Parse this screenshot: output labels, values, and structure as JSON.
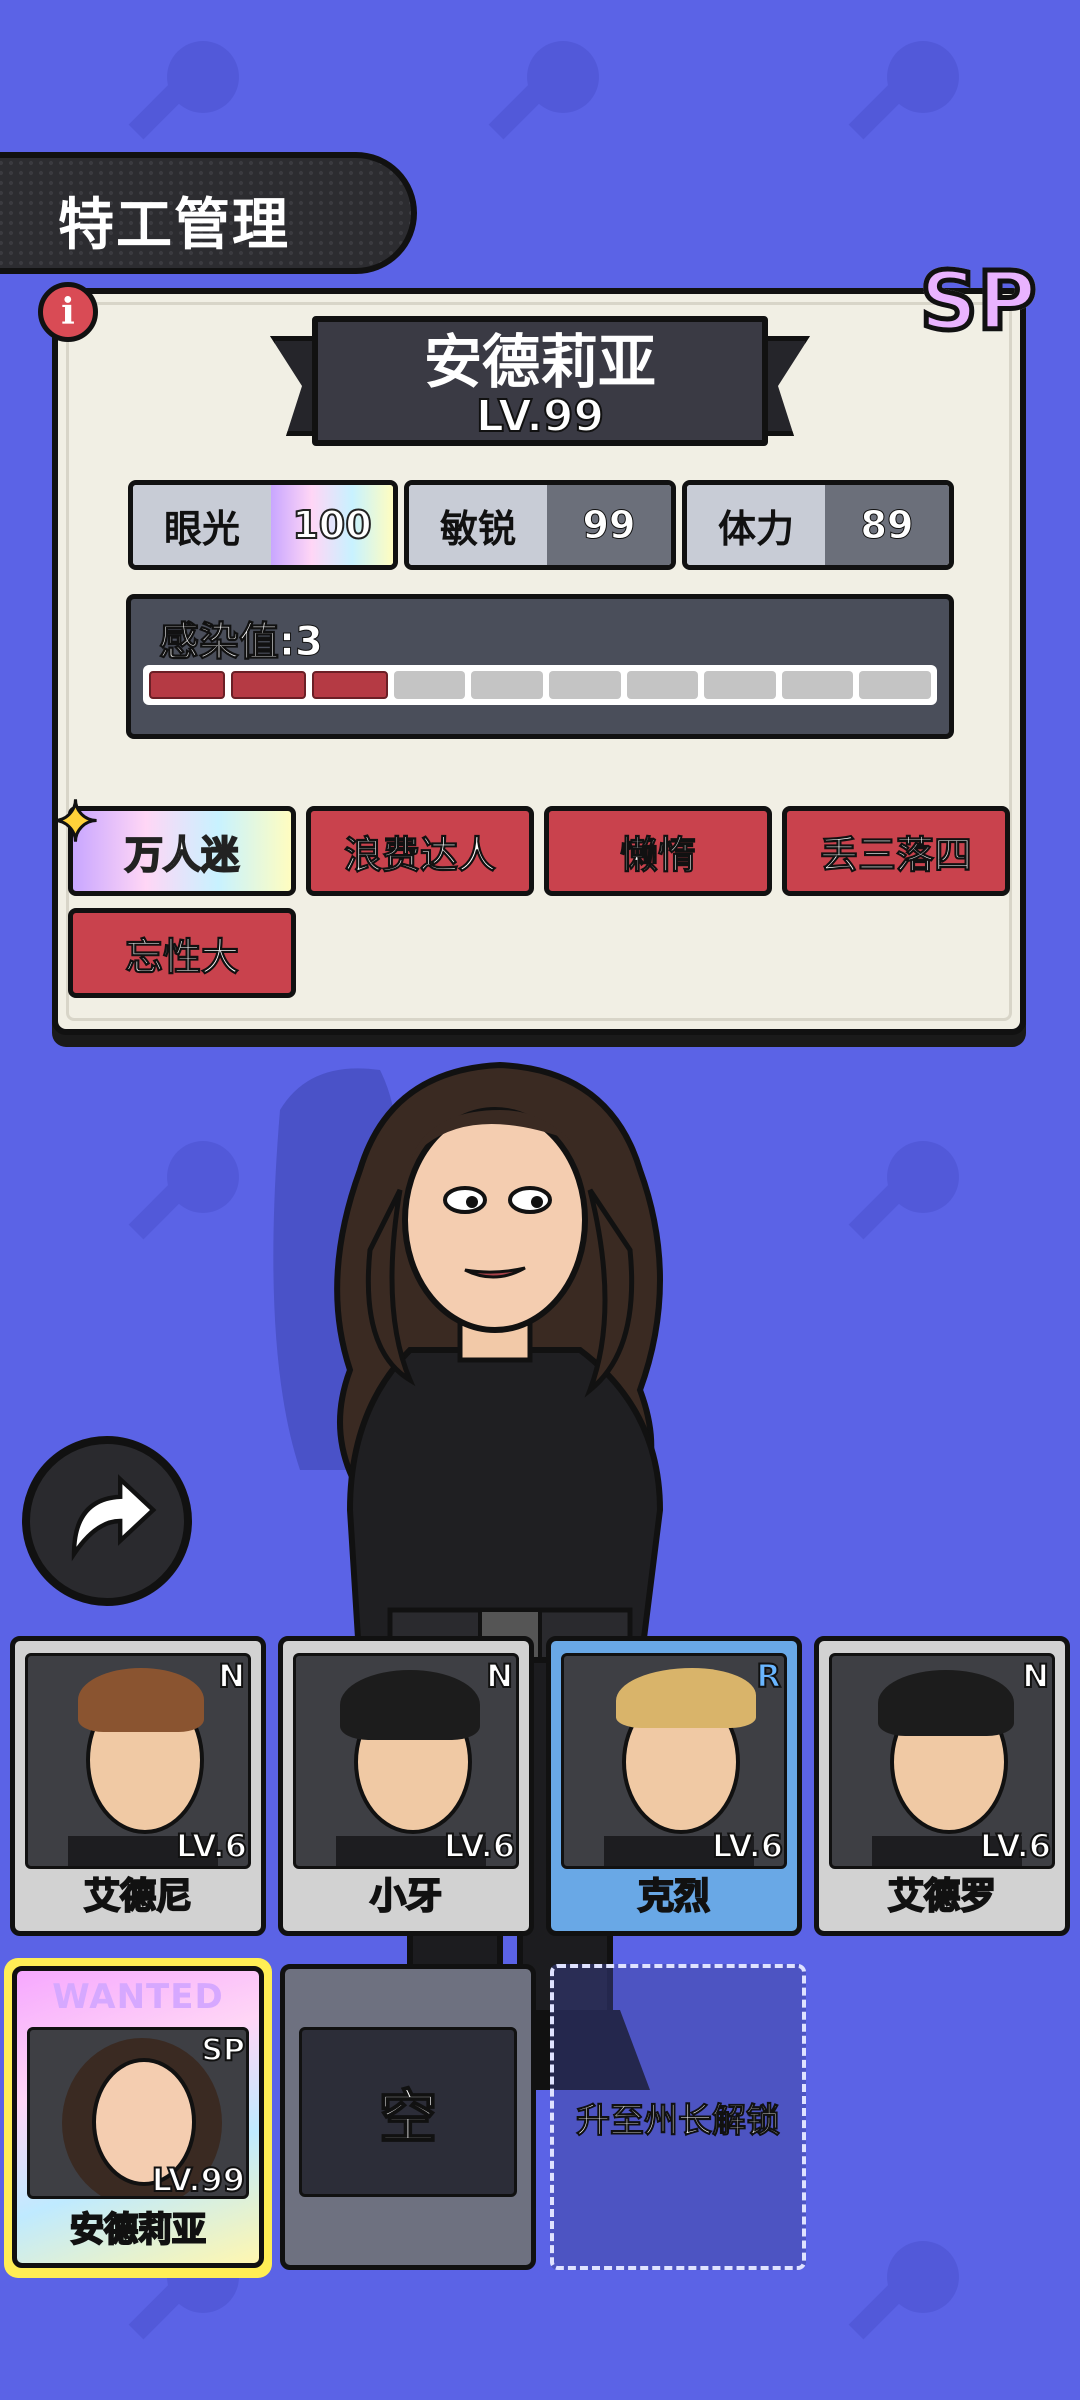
{
  "header": {
    "title": "特工管理"
  },
  "info_icon": "info-icon",
  "rarity_badge": "SP",
  "agent": {
    "name": "安德莉亚",
    "level": "LV.99"
  },
  "stats": [
    {
      "label": "眼光",
      "value": "100"
    },
    {
      "label": "敏锐",
      "value": "99"
    },
    {
      "label": "体力",
      "value": "89"
    }
  ],
  "infection": {
    "label": "感染值:3",
    "level": 3,
    "max": 10
  },
  "traits": [
    "万人迷",
    "浪费达人",
    "懒惰",
    "丢三落四",
    "忘性大"
  ],
  "roster": [
    {
      "name": "艾德尼",
      "rarity": "N",
      "level": "LV.6"
    },
    {
      "name": "小牙",
      "rarity": "N",
      "level": "LV.6"
    },
    {
      "name": "克烈",
      "rarity": "R",
      "level": "LV.6"
    },
    {
      "name": "艾德罗",
      "rarity": "N",
      "level": "LV.6"
    }
  ],
  "squad": {
    "selected": {
      "tag": "WANTED",
      "rarity": "SP",
      "level": "LV.99",
      "name": "安德莉亚"
    },
    "empty_label": "空",
    "locked_label": "升至州长解锁"
  },
  "colors": {
    "background": "#5b63e6",
    "panel": "#f1efe4",
    "trait_red": "#c9424d",
    "infection_red": "#b53a44"
  }
}
